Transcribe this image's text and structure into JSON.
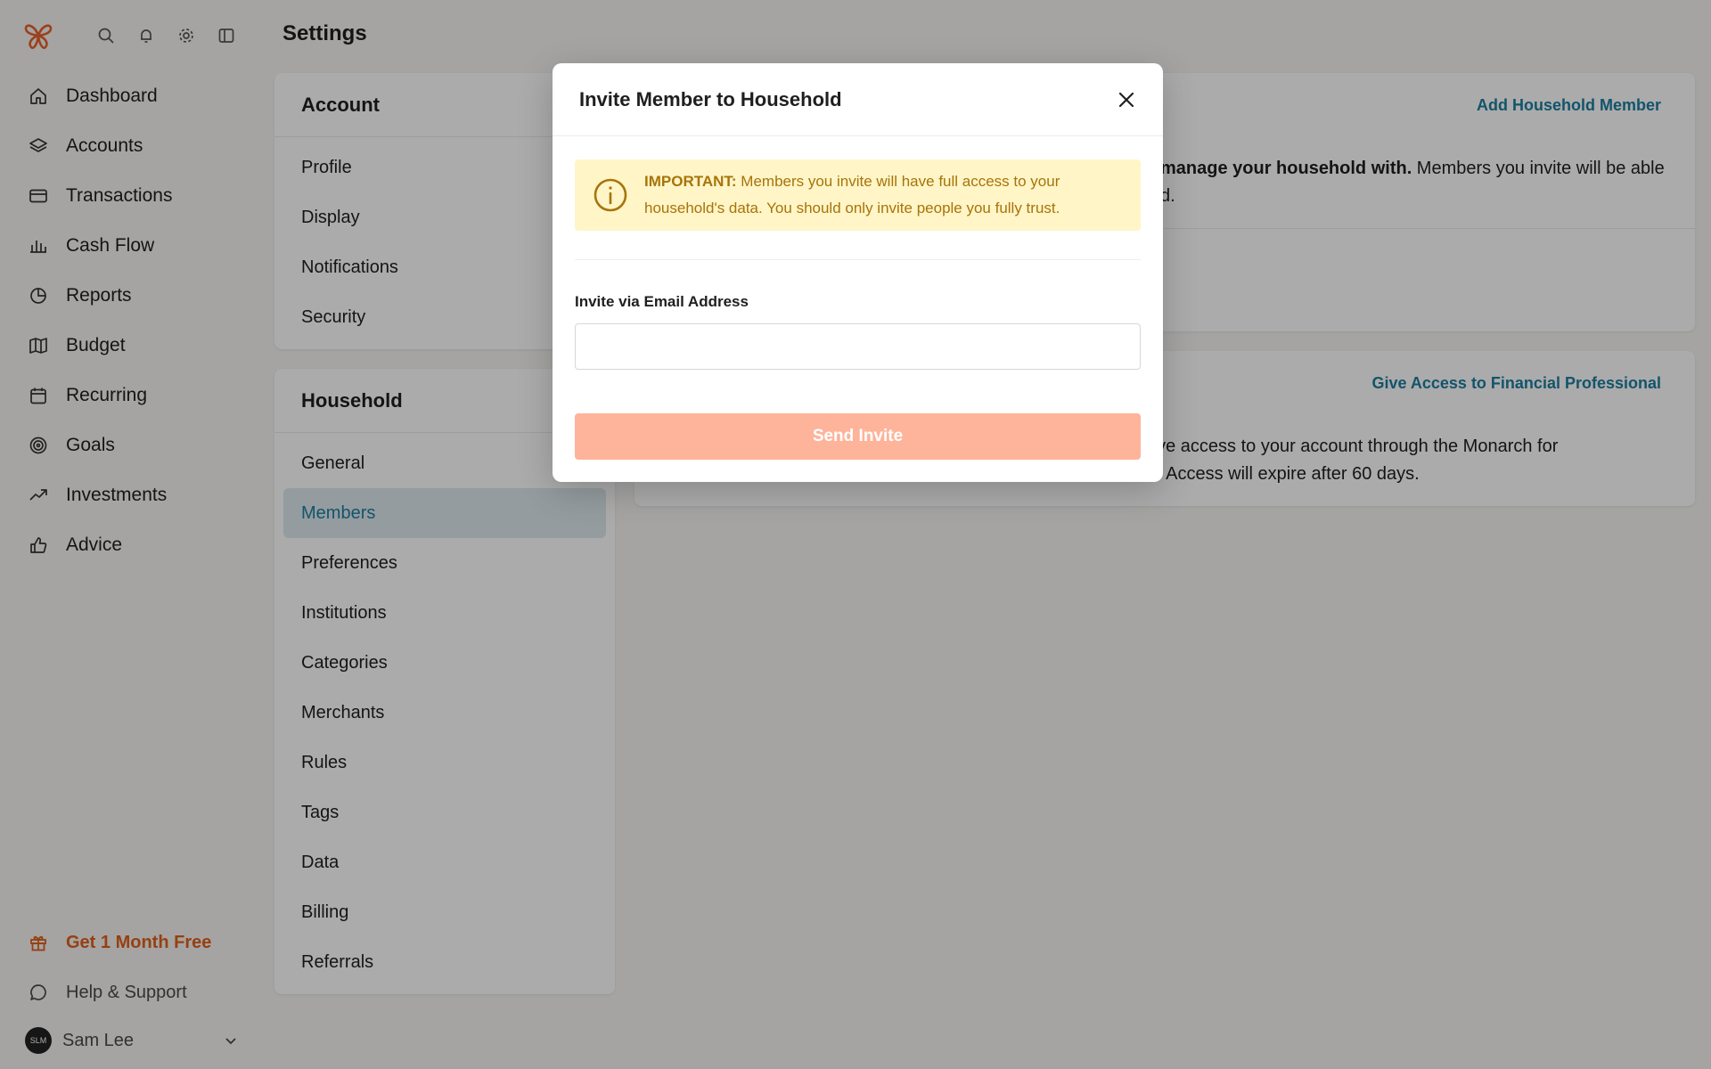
{
  "app": {
    "page_title": "Settings",
    "top_icons": [
      "search-icon",
      "bell-icon",
      "gear-icon",
      "sidebar-toggle-icon"
    ]
  },
  "sidebar": {
    "nav": [
      {
        "label": "Dashboard",
        "icon": "home-icon"
      },
      {
        "label": "Accounts",
        "icon": "layers-icon"
      },
      {
        "label": "Transactions",
        "icon": "card-icon"
      },
      {
        "label": "Cash Flow",
        "icon": "bar-chart-icon"
      },
      {
        "label": "Reports",
        "icon": "pie-chart-icon"
      },
      {
        "label": "Budget",
        "icon": "map-icon"
      },
      {
        "label": "Recurring",
        "icon": "calendar-icon"
      },
      {
        "label": "Goals",
        "icon": "target-icon"
      },
      {
        "label": "Investments",
        "icon": "trend-icon"
      },
      {
        "label": "Advice",
        "icon": "thumbs-up-icon"
      }
    ],
    "promo_label": "Get 1 Month Free",
    "help_label": "Help & Support",
    "user": {
      "name": "Sam Lee",
      "initials": "SLM"
    }
  },
  "settings_menu": {
    "account": {
      "title": "Account",
      "items": [
        "Profile",
        "Display",
        "Notifications",
        "Security"
      ]
    },
    "household": {
      "title": "Household",
      "items": [
        "General",
        "Members",
        "Preferences",
        "Institutions",
        "Categories",
        "Merchants",
        "Rules",
        "Tags",
        "Data",
        "Billing",
        "Referrals"
      ],
      "active": "Members"
    }
  },
  "members_panel": {
    "add_link": "Add Household Member",
    "text_bold": "manage your household with.",
    "text_line1_rest": " Members you invite will be able",
    "text_line2": "d."
  },
  "pro_panel": {
    "link": "Give Access to Financial Professional",
    "text_line1": "ave access to your account through the Monarch for",
    "text_line2": "e. Access will expire after 60 days."
  },
  "modal": {
    "title": "Invite Member to Household",
    "warning_prefix": "IMPORTANT:",
    "warning_line1": " Members you invite will have full access to your",
    "warning_line2": "household's data. You should only invite people you fully trust.",
    "field_label": "Invite via Email Address",
    "email_value": "",
    "send_label": "Send Invite"
  },
  "colors": {
    "accent_blue": "#1d7ea0",
    "promo_orange": "#e0601b",
    "warning_bg": "#fff5c7",
    "warning_text": "#a7740a",
    "send_button": "#fdb49a"
  }
}
